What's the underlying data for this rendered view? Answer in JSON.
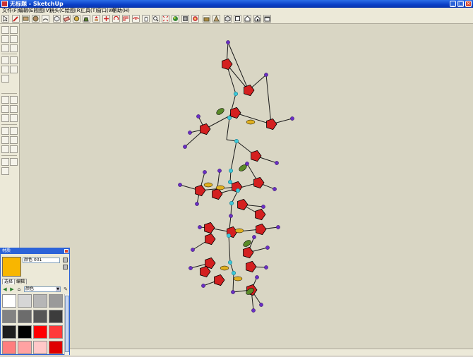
{
  "window": {
    "title": "无标题 - SketchUp",
    "controls": [
      "minimize",
      "maximize",
      "close"
    ]
  },
  "menubar": {
    "items": [
      "文件(F)",
      "编辑(E)",
      "视图(V)",
      "镜头(C)",
      "绘图(R)",
      "工具(T)",
      "窗口(W)",
      "帮助(H)"
    ]
  },
  "toolbar": {
    "icons": [
      "select-icon",
      "pencil-icon",
      "rectangle-icon",
      "circle-icon",
      "arc-icon",
      "make-component-icon",
      "eraser-icon",
      "tape-measure-icon",
      "paint-bucket-icon",
      "push-pull-icon",
      "move-icon",
      "rotate-icon",
      "offset-icon",
      "orbit-icon",
      "pan-icon",
      "zoom-icon",
      "zoom-extents-icon",
      "materials-icon",
      "components-icon",
      "styles-icon",
      "layers-icon",
      "shadows-icon",
      "iso-view-icon",
      "top-view-icon",
      "front-view-icon",
      "right-view-icon",
      "back-view-icon",
      "left-view-icon"
    ]
  },
  "materials_panel": {
    "title": "材质",
    "material_name": "颜色 001",
    "current_color": "#f8b600",
    "tabs": [
      "选择",
      "编辑"
    ],
    "library": "颜色",
    "swatches": [
      "#ffffff",
      "#d6d6d6",
      "#b6b6b6",
      "#9a9a9a",
      "#828282",
      "#6c6c6c",
      "#565656",
      "#3c3c3c",
      "#1e1e1e",
      "#000000",
      "#ff0000",
      "#ff3a3a",
      "#ff7e7e",
      "#ffa2a2",
      "#ffc8c8",
      "#e00000"
    ]
  },
  "model": {
    "description_colors": {
      "ring": "#d42020",
      "bond": "#1a1a1a",
      "endpoint": "#6a2fc4",
      "ion": "#3cc8d8",
      "yellow": "#e0b020",
      "green": "#5a8a28"
    }
  }
}
